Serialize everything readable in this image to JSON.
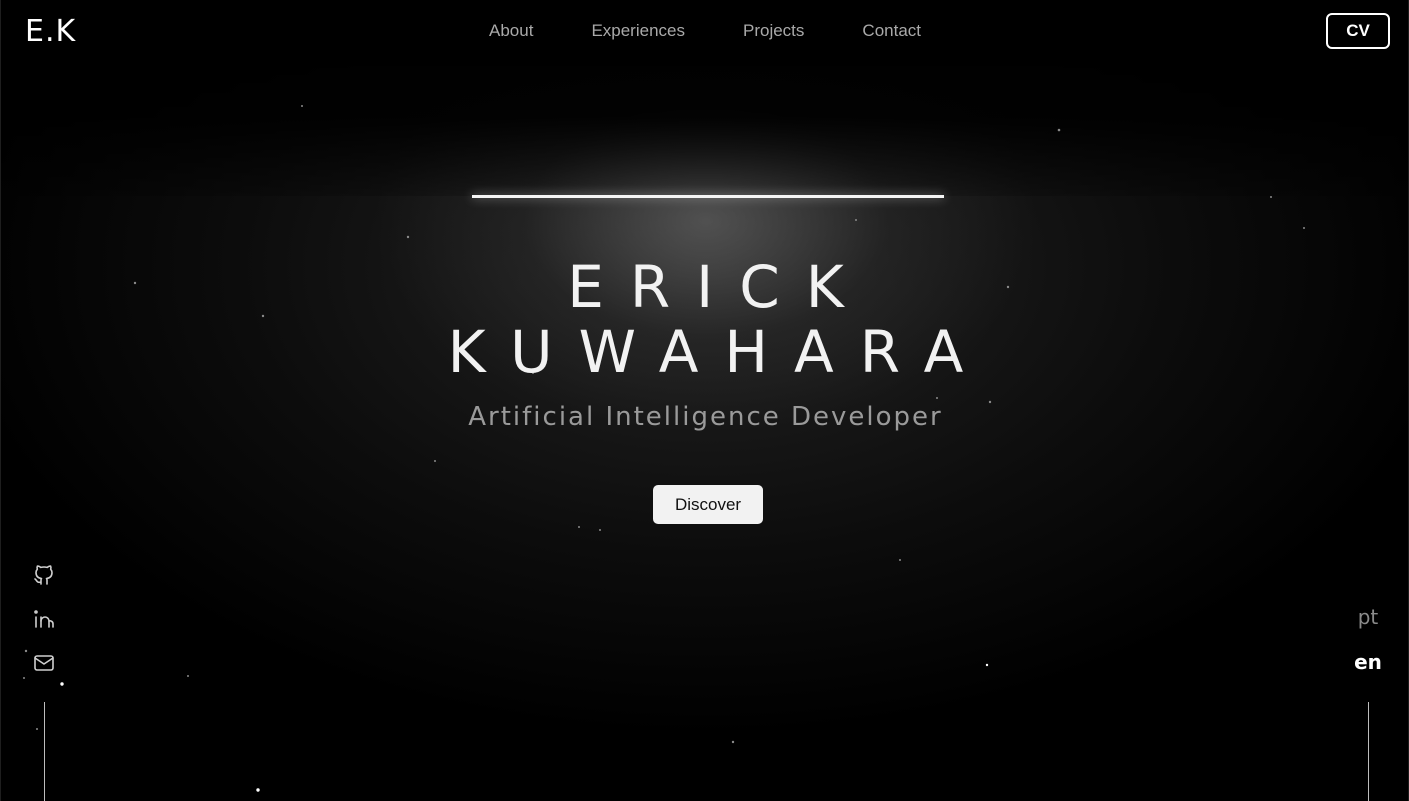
{
  "header": {
    "logo": "E.K",
    "nav": [
      "About",
      "Experiences",
      "Projects",
      "Contact"
    ],
    "cv_label": "CV"
  },
  "hero": {
    "first_name": "ERICK",
    "last_name": "KUWAHARA",
    "subtitle": "Artificial Intelligence Developer",
    "cta_label": "Discover"
  },
  "social": {
    "items": [
      "github-icon",
      "linkedin-icon",
      "mail-icon"
    ]
  },
  "language": {
    "options": [
      "pt",
      "en"
    ],
    "selected": "en"
  },
  "colors": {
    "background": "#000000",
    "text": "#ffffff",
    "nav_text": "#a9a9a9",
    "subtitle": "#9a9a9a",
    "button_bg": "#f2f2f2"
  }
}
